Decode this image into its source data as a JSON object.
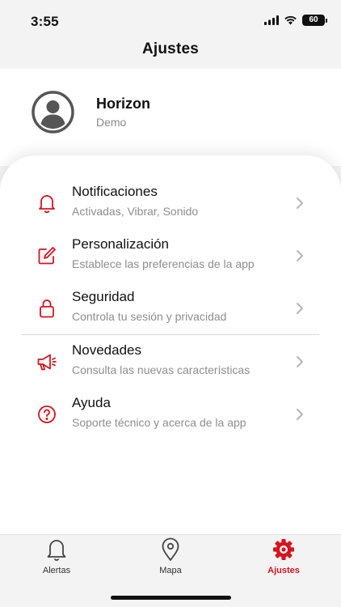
{
  "status_bar": {
    "time": "3:55",
    "battery": "60"
  },
  "header": {
    "title": "Ajustes"
  },
  "profile": {
    "name": "Horizon",
    "subtitle": "Demo"
  },
  "menu": {
    "items": [
      {
        "icon": "bell-icon",
        "title": "Notificaciones",
        "subtitle": "Activadas, Vibrar, Sonido"
      },
      {
        "icon": "edit-icon",
        "title": "Personalización",
        "subtitle": "Establece las preferencias de la app"
      },
      {
        "icon": "lock-icon",
        "title": "Seguridad",
        "subtitle": "Controla tu sesión y privacidad"
      },
      {
        "icon": "megaphone-icon",
        "title": "Novedades",
        "subtitle": "Consulta las nuevas características"
      },
      {
        "icon": "help-icon",
        "title": "Ayuda",
        "subtitle": "Soporte técnico y acerca de la app"
      }
    ]
  },
  "tabs": [
    {
      "label": "Alertas",
      "icon": "bell-icon",
      "active": false
    },
    {
      "label": "Mapa",
      "icon": "map-pin-icon",
      "active": false
    },
    {
      "label": "Ajustes",
      "icon": "gear-icon",
      "active": true
    }
  ],
  "colors": {
    "accent": "#d6141e",
    "background": "#f3f3f3",
    "card": "#ffffff",
    "subtitle": "#8e8e8e"
  }
}
